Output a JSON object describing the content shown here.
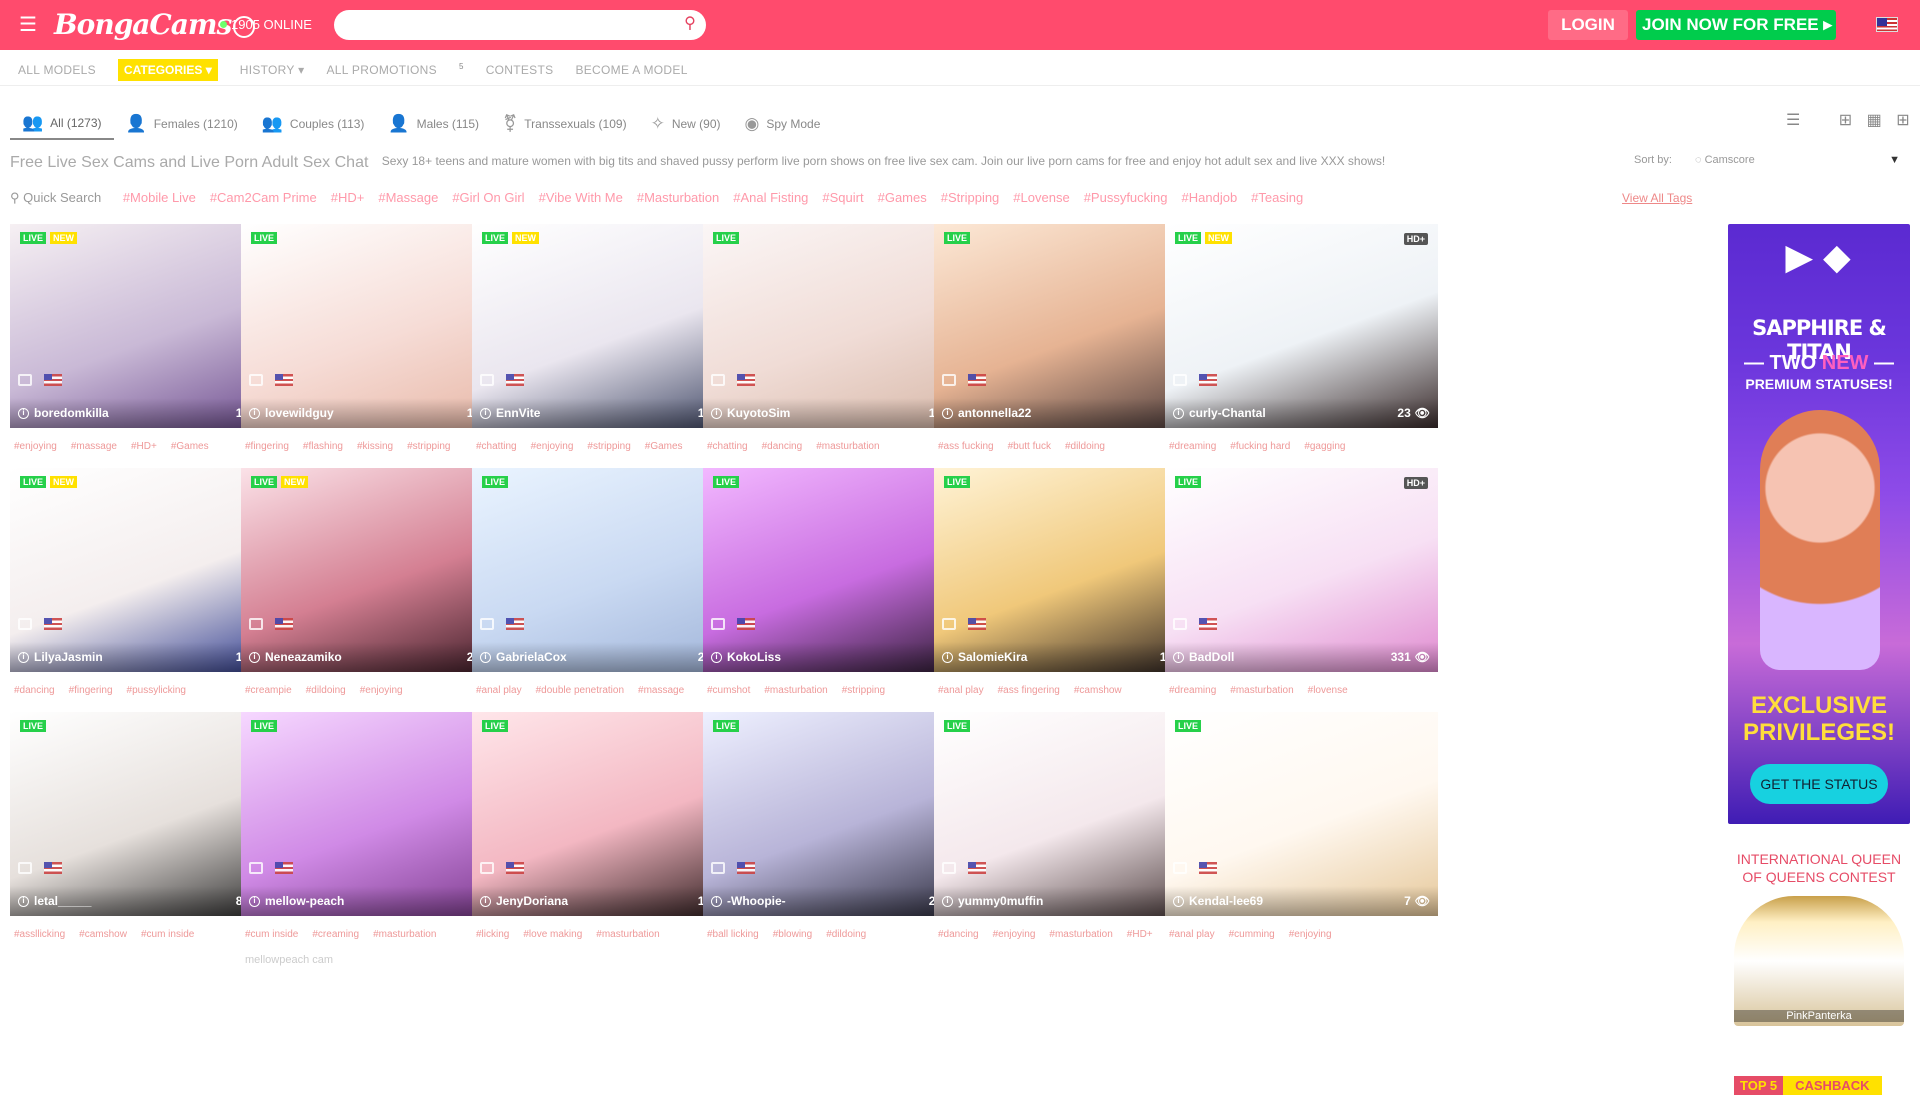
{
  "header": {
    "logo_text": "BongaCams",
    "online_count": "1905 ONLINE",
    "search_placeholder": "",
    "login_label": "LOGIN",
    "join_label": "JOIN NOW FOR FREE"
  },
  "nav": {
    "items": [
      "ALL MODELS",
      "CATEGORIES ▾",
      "HISTORY ▾",
      "ALL PROMOTIONS",
      "CONTESTS",
      "BECOME A MODEL"
    ],
    "promotions_badge": "5"
  },
  "tabs": [
    {
      "label": "All (1273)",
      "icon": "group-icon"
    },
    {
      "label": "Females (1210)",
      "icon": "female-icon"
    },
    {
      "label": "Couples (113)",
      "icon": "couple-icon"
    },
    {
      "label": "Males (115)",
      "icon": "male-icon"
    },
    {
      "label": "Transsexuals (109)",
      "icon": "trans-icon"
    },
    {
      "label": "New (90)",
      "icon": "sparkle-icon"
    },
    {
      "label": "Spy Mode",
      "icon": "eye-icon"
    }
  ],
  "page": {
    "title": "Free Live Sex Cams and Live Porn Adult Sex Chat",
    "subtitle": "Sexy 18+ teens and mature women with big tits and shaved pussy perform live porn shows on free live sex cam. Join our live porn cams for free and enjoy hot adult sex and live XXX shows!",
    "sort_label": "Sort by:",
    "sort_value": "Camscore"
  },
  "tagbar": {
    "quick_search": "Quick Search",
    "tags": [
      "#Mobile Live",
      "#Cam2Cam Prime",
      "#HD+",
      "#Massage",
      "#Girl On Girl",
      "#Vibe With Me",
      "#Masturbation",
      "#Anal Fisting",
      "#Squirt",
      "#Games",
      "#Stripping",
      "#Lovense",
      "#Pussyfucking",
      "#Handjob",
      "#Teasing"
    ],
    "view_all": "View All Tags"
  },
  "models": [
    {
      "name": "boredomkilla",
      "viewers": "138",
      "new": true,
      "hd": "HD+",
      "tags": [
        "#enjoying",
        "#massage",
        "#HD+",
        "#Games"
      ],
      "desc": "",
      "colors": [
        "#f6f0f3",
        "#c9b9d6",
        "#6d4c8e"
      ]
    },
    {
      "name": "lovewildguy",
      "viewers": "182",
      "new": false,
      "hd": "HD+",
      "tags": [
        "#fingering",
        "#flashing",
        "#kissing",
        "#stripping"
      ],
      "desc": "",
      "colors": [
        "#fff",
        "#f6dcd6",
        "#e7b7a6"
      ]
    },
    {
      "name": "EnnVite",
      "viewers": "170",
      "new": true,
      "hd": "HD+",
      "tags": [
        "#chatting",
        "#enjoying",
        "#stripping",
        "#Games"
      ],
      "desc": "",
      "colors": [
        "#fff",
        "#eae6ef",
        "#3c4462"
      ]
    },
    {
      "name": "KuyotoSim",
      "viewers": "162",
      "new": false,
      "hd": "HD+",
      "tags": [
        "#chatting",
        "#dancing",
        "#masturbation"
      ],
      "desc": "",
      "colors": [
        "#fbf6f6",
        "#f0dcd6",
        "#d7b8a8"
      ]
    },
    {
      "name": "antonnella22",
      "viewers": "",
      "new": false,
      "hd": "HD+",
      "tags": [
        "#ass fucking",
        "#butt fuck",
        "#dildoing"
      ],
      "desc": "",
      "colors": [
        "#fce8d6",
        "#e6b393",
        "#4a3a3a"
      ]
    },
    {
      "name": "curly-Chantal",
      "viewers": "23",
      "new": true,
      "hd": "HD+",
      "tags": [
        "#dreaming",
        "#fucking hard",
        "#gagging"
      ],
      "desc": "",
      "colors": [
        "#fff",
        "#eef2f6",
        "#3a2c2c"
      ]
    },
    {
      "name": "LilyaJasmin",
      "viewers": "141",
      "new": true,
      "hd": "HD+",
      "tags": [
        "#dancing",
        "#fingering",
        "#pussylicking"
      ],
      "desc": "",
      "colors": [
        "#fff",
        "#f4eeee",
        "#2d3a8e"
      ]
    },
    {
      "name": "Neneazamiko",
      "viewers": "236",
      "new": true,
      "hd": "HD+",
      "tags": [
        "#creampie",
        "#dildoing",
        "#enjoying"
      ],
      "desc": "",
      "colors": [
        "#fbe2e8",
        "#d47f92",
        "#3a1a24"
      ]
    },
    {
      "name": "GabrielaCox",
      "viewers": "242",
      "new": false,
      "hd": "HD+",
      "tags": [
        "#anal play",
        "#double penetration",
        "#massage"
      ],
      "desc": "",
      "colors": [
        "#eaf4ff",
        "#c9d9f2",
        "#9fb3d8"
      ]
    },
    {
      "name": "KokoLiss",
      "viewers": "1",
      "new": false,
      "hd": "",
      "tags": [
        "#cumshot",
        "#masturbation",
        "#stripping"
      ],
      "desc": "",
      "colors": [
        "#f2b8ff",
        "#c86ce0",
        "#2a1a2e"
      ]
    },
    {
      "name": "SalomieKira",
      "viewers": "168",
      "new": false,
      "hd": "HD+",
      "tags": [
        "#anal play",
        "#ass fingering",
        "#camshow"
      ],
      "desc": "",
      "colors": [
        "#fff3d6",
        "#f0c87a",
        "#2a2020"
      ]
    },
    {
      "name": "BadDoll",
      "viewers": "331",
      "new": false,
      "hd": "HD+",
      "tags": [
        "#dreaming",
        "#masturbation",
        "#lovense"
      ],
      "desc": "",
      "colors": [
        "#fff",
        "#f7e0f4",
        "#e08ad0"
      ]
    },
    {
      "name": "letal_____",
      "viewers": "804",
      "new": false,
      "hd": "HD",
      "tags": [
        "#assllicking",
        "#camshow",
        "#cum inside"
      ],
      "desc": "",
      "colors": [
        "#fff",
        "#e6e0dc",
        "#2a2a2a"
      ]
    },
    {
      "name": "mellow-peach",
      "viewers": "14",
      "new": false,
      "hd": "HD+",
      "tags": [
        "#cum inside",
        "#creaming",
        "#masturbation"
      ],
      "desc": "mellowpeach cam",
      "colors": [
        "#f6d8ff",
        "#d08ae6",
        "#7a3a8a"
      ]
    },
    {
      "name": "JenyDoriana",
      "viewers": "198",
      "new": false,
      "hd": "HD+",
      "tags": [
        "#licking",
        "#love making",
        "#masturbation"
      ],
      "desc": "",
      "colors": [
        "#ffe6ea",
        "#f3b7c2",
        "#2a1a1a"
      ]
    },
    {
      "name": "-Whoopie-",
      "viewers": "276",
      "new": false,
      "hd": "HD+",
      "tags": [
        "#ball licking",
        "#blowing",
        "#dildoing"
      ],
      "desc": "",
      "colors": [
        "#eef0ff",
        "#b8b4d8",
        "#2a2a3a"
      ]
    },
    {
      "name": "yummy0muffin",
      "viewers": "10",
      "new": false,
      "hd": "HD+",
      "tags": [
        "#dancing",
        "#enjoying",
        "#masturbation",
        "#HD+"
      ],
      "desc": "",
      "colors": [
        "#fff",
        "#f4e8ec",
        "#4a3a3a"
      ]
    },
    {
      "name": "Kendal-lee69",
      "viewers": "7",
      "new": false,
      "hd": "",
      "tags": [
        "#anal play",
        "#cumming",
        "#enjoying"
      ],
      "desc": "",
      "colors": [
        "#fff",
        "#fff8f0",
        "#e6c89a"
      ]
    }
  ],
  "sidebar": {
    "ad_brand": "SAPPHIRE & TITAN",
    "ad_two": "TWO",
    "ad_new": "NEW",
    "ad_premium": "PREMIUM STATUSES!",
    "ad_exclusive": "EXCLUSIVE PRIVILEGES!",
    "ad_button": "GET THE STATUS",
    "contest_title": "INTERNATIONAL QUEEN OF QUEENS CONTEST",
    "contest_model": "PinkPanterka",
    "top5": "TOP 5",
    "cashback": "CASHBACK"
  },
  "colors": {
    "brand": "#ff4b6d",
    "join": "#00cc4c",
    "live": "#26d04a",
    "new": "#ffe100"
  }
}
